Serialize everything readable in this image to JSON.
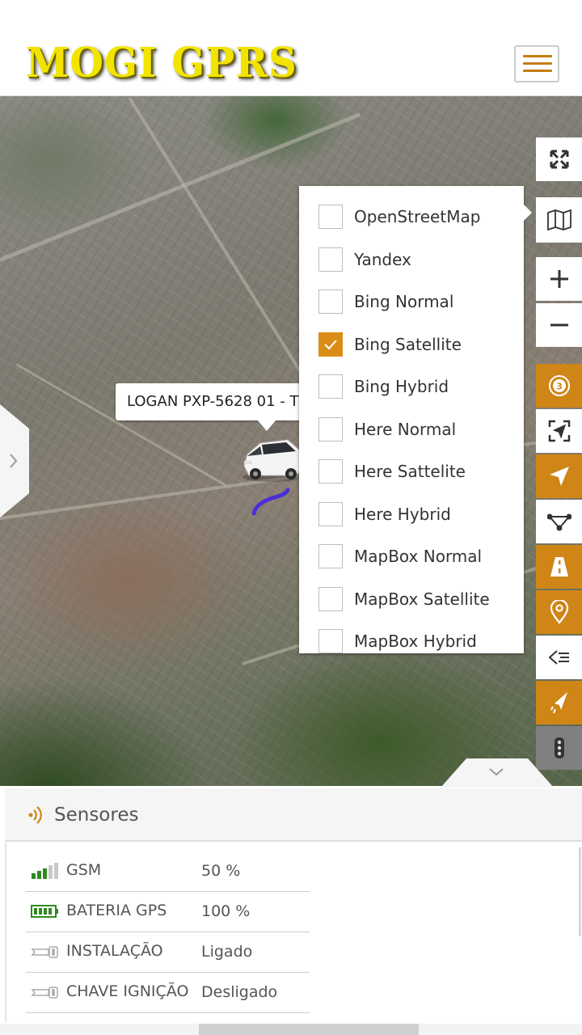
{
  "header": {
    "logo_text": "MOGI GPRS",
    "menu_icon": "hamburger-icon"
  },
  "map": {
    "vehicle_popup": "LOGAN PXP-5628 01 - T",
    "layers": [
      {
        "label": "OpenStreetMap",
        "checked": false
      },
      {
        "label": "Yandex",
        "checked": false
      },
      {
        "label": "Bing Normal",
        "checked": false
      },
      {
        "label": "Bing Satellite",
        "checked": true
      },
      {
        "label": "Bing Hybrid",
        "checked": false
      },
      {
        "label": "Here Normal",
        "checked": false
      },
      {
        "label": "Here Sattelite",
        "checked": false
      },
      {
        "label": "Here Hybrid",
        "checked": false
      },
      {
        "label": "MapBox Normal",
        "checked": false
      },
      {
        "label": "MapBox Satellite",
        "checked": false
      },
      {
        "label": "MapBox Hybrid",
        "checked": false
      }
    ],
    "toolbar": {
      "badge_count": "3",
      "icons": [
        "fullscreen-icon",
        "map-layers-icon",
        "zoom-in-icon",
        "zoom-out-icon",
        "refresh-badge-icon",
        "focus-target-icon",
        "navigation-arrow-icon",
        "polygon-icon",
        "road-icon",
        "map-pin-icon",
        "route-list-icon",
        "route-history-icon",
        "more-vertical-icon"
      ]
    },
    "accent_color": "#cf8616",
    "route_color": "#4a2fd6"
  },
  "sensors": {
    "title": "Sensores",
    "rows": [
      {
        "name": "GSM",
        "value": "50 %",
        "icon": "signal-bars-icon"
      },
      {
        "name": "BATERIA GPS",
        "value": "100 %",
        "icon": "battery-icon"
      },
      {
        "name": "INSTALAÇÃO",
        "value": "Ligado",
        "icon": "key-icon"
      },
      {
        "name": "CHAVE IGNIÇÃO",
        "value": "Desligado",
        "icon": "key-icon"
      }
    ]
  }
}
